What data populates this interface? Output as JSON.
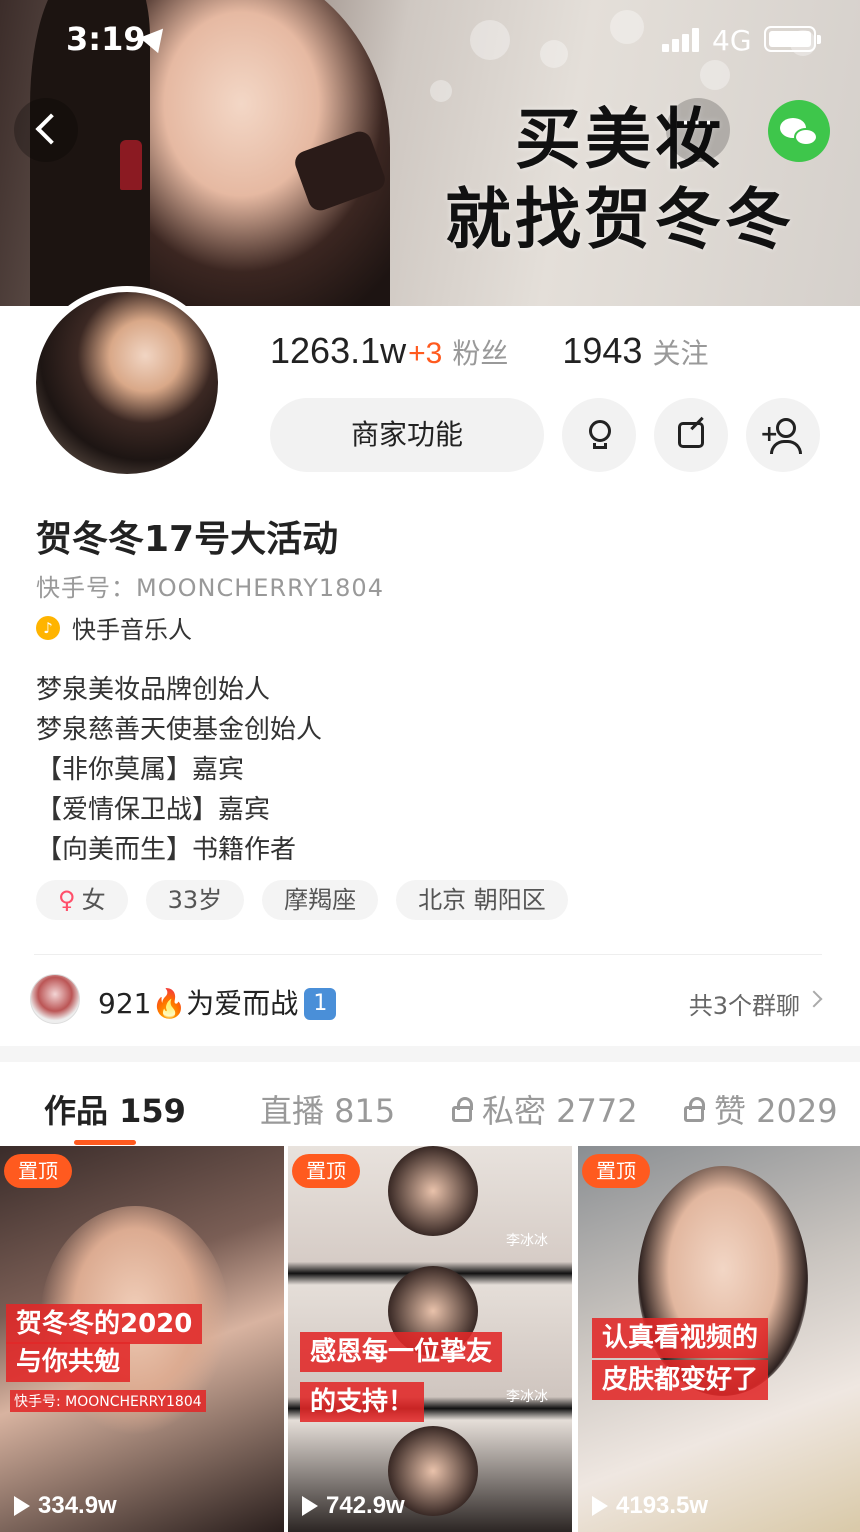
{
  "status_bar": {
    "time": "3:19",
    "network": "4G"
  },
  "banner": {
    "line1": "买美妆",
    "line2": "就找贺冬冬"
  },
  "header_buttons": {
    "more": "···"
  },
  "profile": {
    "followers": "1263.1w",
    "followers_delta": "+3",
    "followers_label": "粉丝",
    "following": "1943",
    "following_label": "关注",
    "merchant_button": "商家功能",
    "name": "贺冬冬17号大活动",
    "kuaishou_id": "快手号：MOONCHERRY1804",
    "music_badge": "快手音乐人",
    "bio": [
      "梦泉美妆品牌创始人",
      "梦泉慈善天使基金创始人",
      "【非你莫属】嘉宾",
      "【爱情保卫战】嘉宾",
      "【向美而生】书籍作者"
    ],
    "tags": {
      "gender": "女",
      "age": "33岁",
      "zodiac": "摩羯座",
      "location": "北京 朝阳区"
    }
  },
  "group_chat": {
    "name": "921🔥为爱而战",
    "badge": "1",
    "count_text": "共3个群聊"
  },
  "tabs": [
    {
      "label": "作品 159",
      "active": true
    },
    {
      "label": "直播 815",
      "active": false
    },
    {
      "label": "私密 2772",
      "active": false,
      "locked": true
    },
    {
      "label": "赞 2029",
      "active": false,
      "locked": true
    }
  ],
  "videos": [
    {
      "pin": "置顶",
      "caption1": "贺冬冬的2020",
      "caption2": "与你共勉",
      "watermark": "快手号: MOONCHERRY1804",
      "views": "334.9w"
    },
    {
      "pin": "置顶",
      "caption1": "感恩每一位挚友",
      "caption2": "的支持！",
      "watermark": "李冰冰",
      "views": "742.9w"
    },
    {
      "pin": "置顶",
      "caption1": "认真看视频的",
      "caption2": "皮肤都变好了",
      "views": "4193.5w"
    }
  ],
  "colors": {
    "accent": "#ff5a1f",
    "wechat": "#3ec64b"
  }
}
